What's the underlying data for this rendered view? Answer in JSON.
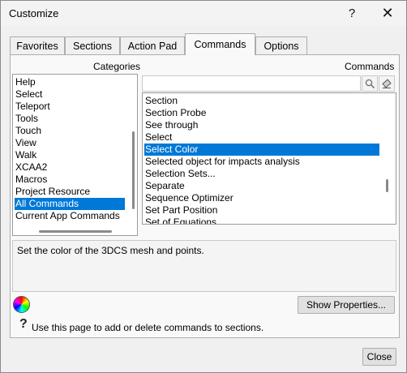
{
  "window": {
    "title": "Customize",
    "help_glyph": "?",
    "close_glyph": "✕"
  },
  "tabs": [
    {
      "label": "Favorites",
      "active": false
    },
    {
      "label": "Sections",
      "active": false
    },
    {
      "label": "Action Pad",
      "active": false
    },
    {
      "label": "Commands",
      "active": true
    },
    {
      "label": "Options",
      "active": false
    }
  ],
  "categories": {
    "header": "Categories",
    "items": [
      "Help",
      "Select",
      "Teleport",
      "Tools",
      "Touch",
      "View",
      "Walk",
      "XCAA2",
      "Macros",
      "Project Resource",
      "All Commands",
      "Current App Commands"
    ],
    "selected": "All Commands"
  },
  "commands": {
    "header": "Commands",
    "search_value": "",
    "items": [
      "Section",
      "Section Probe",
      "See through",
      "Select",
      "Select Color",
      "Selected object for impacts analysis",
      "Selection Sets...",
      "Separate",
      "Sequence Optimizer",
      "Set Part Position",
      "Set of Equations"
    ],
    "selected": "Select Color"
  },
  "description": "Set the color of the 3DCS mesh and points.",
  "show_properties_label": "Show Properties...",
  "help_text": "Use this page to add or delete commands to sections.",
  "close_label": "Close",
  "colors": {
    "selection": "#0078d7",
    "panel": "#f9f9f9"
  }
}
